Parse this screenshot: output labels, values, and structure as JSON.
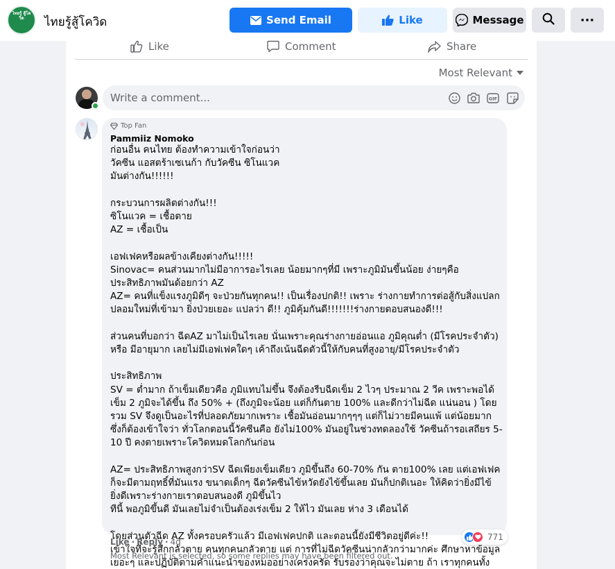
{
  "colors": {
    "brand": "#1877f2",
    "brand_light": "#e7f3ff",
    "love": "#f33e58",
    "online": "#31a24c"
  },
  "header": {
    "page_name": "ไทยรู้สู้โควิด",
    "logo_text": "ไทยรู้ สู้โควิด",
    "buttons": {
      "send_email": {
        "label": "Send Email",
        "icon": "envelope-icon"
      },
      "like": {
        "label": "Like",
        "icon": "thumbs-up-icon"
      },
      "message": {
        "label": "Message",
        "icon": "messenger-icon"
      },
      "search": {
        "icon": "search-icon"
      },
      "more": {
        "label": "···",
        "icon": "more-icon"
      }
    }
  },
  "post_actions": {
    "like": "Like",
    "comment": "Comment",
    "share": "Share"
  },
  "sort": {
    "label": "Most Relevant"
  },
  "composer": {
    "placeholder": "Write a comment...",
    "icons": [
      "emoji-icon",
      "camera-icon",
      "gif-icon",
      "sticker-icon"
    ]
  },
  "comment": {
    "badge": "Top Fan",
    "author": "Pammiiz Nomoko",
    "text": "ก่อนอื่น คนไทย ต้องทำความเข้าใจก่อนว่า\nวัคซีน แอสตร้าเซเนก้า กับวัคซีน ซิโนแวค\nมันต่างกัน!!!!!!\n\nกระบวนการผลิตต่างกัน!!!\nซิโนแวค = เชื้อตาย\nAZ = เชื้อเป็น\n\nเอฟเฟคหรือผลข้างเคียงต่างกัน!!!!!\nSinovac= คนส่วนมากไม่มีอาการอะไรเลย น้อยมากๆที่มี เพราะภูมิมันขึ้นน้อย ง่ายๆคือ ประสิทธิภาพมันด้อยกว่า AZ\nAZ= คนที่แข็งแรงภูมิดีๆ จะป่วยกันทุกคน!! เป็นเรื่องปกติ!! เพราะ ร่างกายทำการต่อสู้กับสิ่งแปลกปลอมใหม่ที่เข้ามา ยิ่งป่วยเยอะ แปลว่า ดี!! ภูมิคุ้มกันดี!!!!!!!ร่างกายตอบสนองดี!!!\n\nส่วนคนที่บอกว่า ฉีดAZ มาไม่เป็นไรเลย นั่นเพราะคุณร่างกายอ่อนแอ ภูมิคุณต่ำ (มีโรคประจำตัว) หรือ มีอายุมาก เลยไม่มีเอฟเฟคใดๆ เค้าถึงเน้นฉีดตัวนี้ให้กับคนที่สูงอายุ/มีโรคประจำตัว\n\nประสิทธิภาพ\nSV = ต่ำมาก ถ้าเข็มเดียวคือ ภูมิแทบไม่ขึ้น จึงต้องรีบฉีดเข็ม 2 ไวๆ ประมาณ 2 วีค เพราะพอได้เข็ม 2 ภูมิจะได้ขึ้น ถึง 50% + (ถึงภูมิจะน้อย แต่ก็กันตาย 100% และดีกว่าไม่ฉีด แน่นอน ) โดยรวม SV จึงดูเป็นอะไรที่ปลอดภัยมากเพราะ เชื้อมันอ่อนมากๆๆๆ แต่ก็ไม่วายมีคนแพ้ แต่น้อยมาก ซึ่งก็ต้องเข้าใจว่า ทั่วโลกตอนนี้วัคซีนคือ ยังไม่100% มันอยู่ในช่วงทดลองใช้ วัคซีนถ้ารอเสถียร 5-10 ปี คงตายเพราะโควิดหมดโลกกันก่อน\n\nAZ= ประสิทธิภาพสูงกว่าSV ฉีดเพียงเข็มเดียว ภูมิขึ้นถึง 60-70% กัน ตาย100% เลย แต่เอฟเฟคก็จะมีตามฤทธิ์ที่มันแรง ขนาดเด็กๆ ฉีดวัคซีนไข้หวัดยังไข้ขึ้นเลย มันก็ปกติเนอะ ให้คิดว่ายิ่งมีไข้ ยิ่งดีเพราะร่างกายเราตอบสนองดี ภูมิขึ้นไว\nทีนี้ พอภูมิขึ้นดี มันเลยไม่จำเป็นต้องเร่งเข็ม 2 ให้ไว มันเลย ห่าง 3 เดือนได้\n\nโดยส่วนตัวฉีด AZ ทั้งครอบครัวแล้ว มีเอฟเฟคปกติ และตอนนี้ยังมีชีวิตอยู่ดีค่ะ!!\nเข้าใจที่จะรู้สึกกลัวตาย คนทุกคนกลัวตาย แต่ การที่ไม่ฉีดวัคซีนน่ากลัวกว่ามากค่ะ ศึกษาหาข้อมูลเยอะๆ และปฏิบัติตามคำแนะนำของหมออย่างเคร่งครัด รับรองว่าคุณจะไม่ตาย ถ้า เราทุกคนทั้งประเทศรีบฉีดให้ครบทุกคน เศรษฐกิจ การใช้ชีวิตเหมือนเดิมจะกลับมาในเร็ววันค่ะ",
    "reaction_count": "771",
    "like_link": "Like",
    "reply_link": "Reply",
    "separator": "·",
    "time": "4d"
  },
  "filter_note": "Most Relevant is selected, so some replies may have been filtered out."
}
